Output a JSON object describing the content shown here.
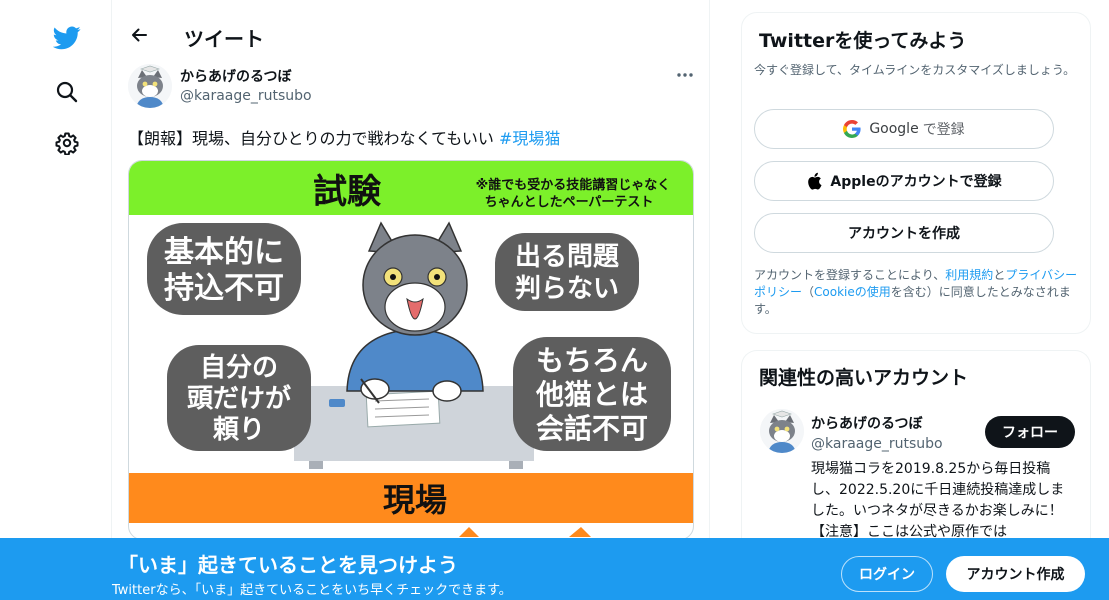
{
  "header": {
    "title": "ツイート"
  },
  "tweet": {
    "author_name": "からあげのるつぼ",
    "author_handle": "@karaage_rutsubo",
    "text": "【朗報】現場、自分ひとりの力で戦わなくてもいい ",
    "hashtag": "#現場猫"
  },
  "media": {
    "top_band": "試験",
    "top_note_line1": "※誰でも受かる技能講習じゃなく",
    "top_note_line2": "ちゃんとしたペーパーテスト",
    "bubble1_line1": "基本的に",
    "bubble1_line2": "持込不可",
    "bubble2_line1": "出る問題",
    "bubble2_line2": "判らない",
    "bubble3_line1": "自分の",
    "bubble3_line2": "頭だけが",
    "bubble3_line3": "頼り",
    "bubble4_line1": "もちろん",
    "bubble4_line2": "他猫とは",
    "bubble4_line3": "会話不可",
    "bottom_band": "現場",
    "colors": {
      "green": "#7cf02a",
      "orange": "#ff8a1c",
      "bubble": "#5e5e5e"
    }
  },
  "signup_card": {
    "title": "Twitterを使ってみよう",
    "subtitle": "今すぐ登録して、タイムラインをカスタマイズしましょう。",
    "google_label": "Google",
    "google_suffix": "で登録",
    "apple_label": "Appleのアカウントで登録",
    "create_label": "アカウントを作成",
    "legal_prefix": "アカウントを登録することにより、",
    "terms_link": "利用規約",
    "legal_and": "と",
    "privacy_link": "プライバシーポリシー",
    "legal_paren_open": "（",
    "cookie_link": "Cookieの使用",
    "legal_suffix": "を含む）に同意したとみなされます。"
  },
  "related_card": {
    "title": "関連性の高いアカウント",
    "name": "からあげのるつぼ",
    "handle": "@karaage_rutsubo",
    "follow_label": "フォロー",
    "bio": "現場猫コラを2019.8.25から毎日投稿し、2022.5.20に千日連続投稿達成しました。いつネタが尽きるかお楽しみに！　【注意】ここは公式や原作では"
  },
  "banner": {
    "title": "「いま」起きていることを見つけよう",
    "subtitle": "Twitterなら、「いま」起きていることをいち早くチェックできます。",
    "login_label": "ログイン",
    "signup_label": "アカウント作成"
  },
  "icons": {
    "nav": [
      "twitter-bird-icon",
      "search-icon",
      "gear-icon"
    ],
    "brand_color": "#1d9bf0"
  }
}
